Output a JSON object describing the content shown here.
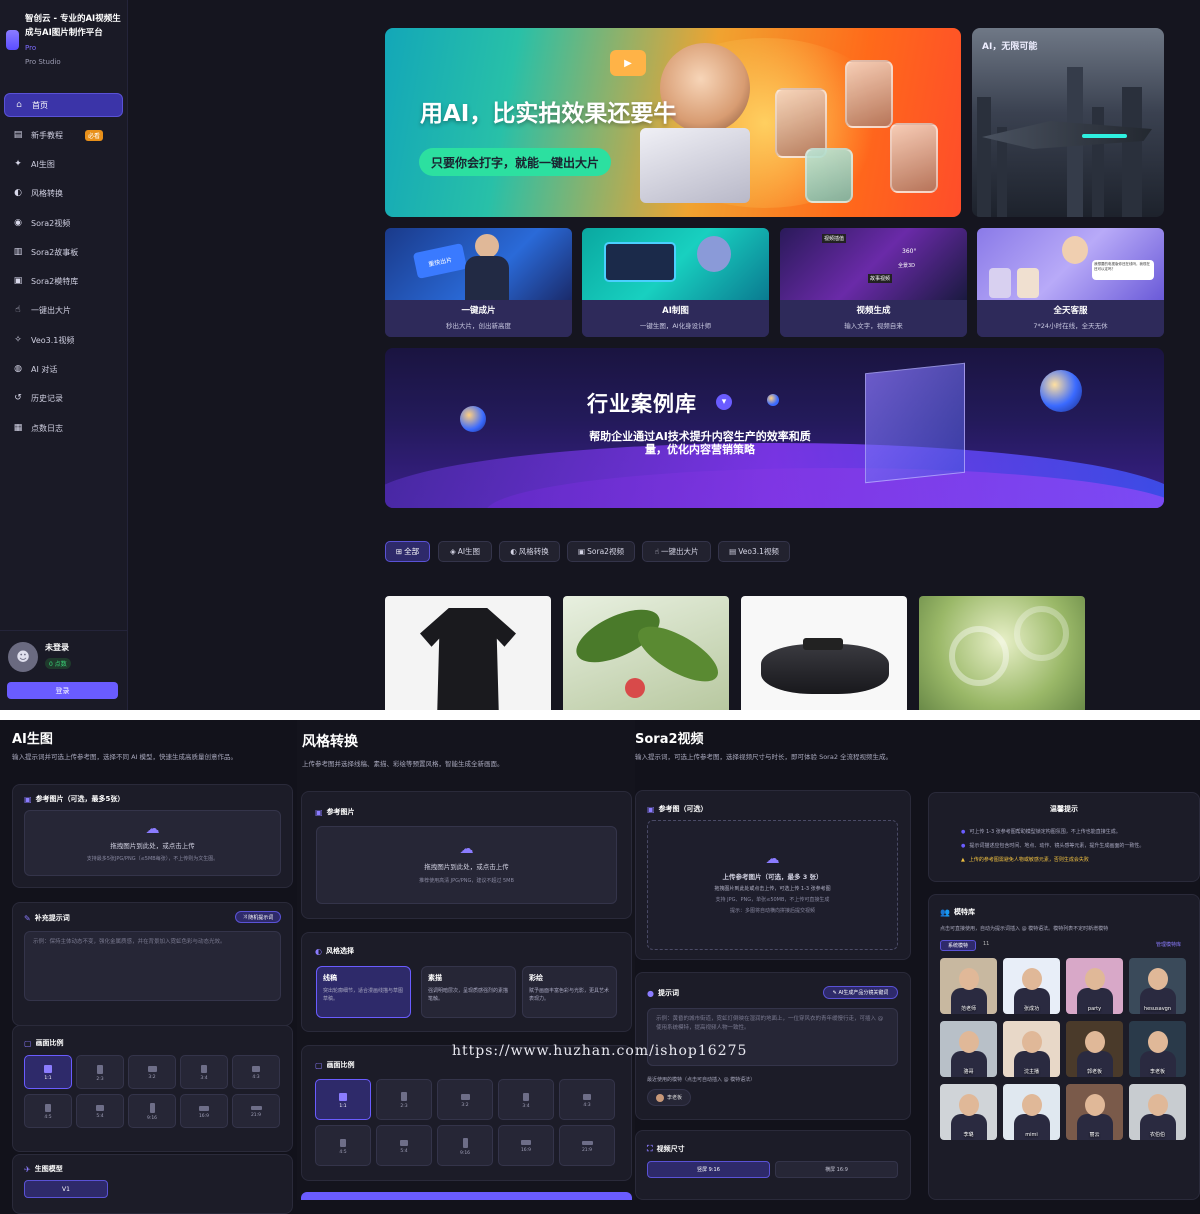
{
  "brand": {
    "title": "智创云 - 专业的AI视频生成与AI图片制作平台",
    "pro": "Pro",
    "studio": "Pro Studio"
  },
  "nav": [
    {
      "label": "首页",
      "icon": "home-icon",
      "glyph": "⌂"
    },
    {
      "label": "新手教程",
      "icon": "book-icon",
      "glyph": "▤",
      "badge": "必看"
    },
    {
      "label": "AI生图",
      "icon": "sparkle-icon",
      "glyph": "✦"
    },
    {
      "label": "风格转换",
      "icon": "palette-icon",
      "glyph": "◐"
    },
    {
      "label": "Sora2视频",
      "icon": "sora-icon",
      "glyph": "◉"
    },
    {
      "label": "Sora2故事板",
      "icon": "storyboard-icon",
      "glyph": "▥"
    },
    {
      "label": "Sora2模特库",
      "icon": "model-icon",
      "glyph": "▣"
    },
    {
      "label": "一键出大片",
      "icon": "thumb-icon",
      "glyph": "☝"
    },
    {
      "label": "Veo3.1视频",
      "icon": "veo-icon",
      "glyph": "✧"
    },
    {
      "label": "AI 对话",
      "icon": "chat-icon",
      "glyph": "◍"
    },
    {
      "label": "历史记录",
      "icon": "history-icon",
      "glyph": "↺"
    },
    {
      "label": "点数日志",
      "icon": "log-icon",
      "glyph": "▦"
    }
  ],
  "user": {
    "name": "未登录",
    "points": "0 点数",
    "login": "登录"
  },
  "hero": {
    "title": "用AI，比实拍效果还要牛",
    "subtitle": "只要你会打字，就能一键出大片"
  },
  "side_banner": {
    "title": "AI，无限可能"
  },
  "features": [
    {
      "title": "一键成片",
      "sub": "秒出大片，创出新高度",
      "tag": "重快出片"
    },
    {
      "title": "AI制图",
      "sub": "一键生图，AI化身设计师"
    },
    {
      "title": "视频生成",
      "sub": "输入文字，视频自来",
      "tag1": "视频插值",
      "tag2": "全景3D",
      "tag3": "故事视频",
      "tag4": "360°"
    },
    {
      "title": "全天客服",
      "sub": "7*24小时在线，全天无休",
      "bubble": "我想要的电视版你还在线吗，我现在还可以定吗？"
    }
  ],
  "industry": {
    "title": "行业案例库",
    "desc": "帮助企业通过AI技术提升内容生产的效率和质量，优化内容营销策略"
  },
  "filters": [
    "全部",
    "AI生图",
    "风格转换",
    "Sora2视频",
    "一键出大片",
    "Veo3.1视频"
  ],
  "ai_gen": {
    "title": "AI生图",
    "desc": "输入提示词并可选上传参考图，选择不同 AI 模型，快速生成高质量创意作品。",
    "ref_label": "参考图片（可选，最多5张）",
    "drop_main": "拖拽图片到此处，或点击上传",
    "drop_hint": "支持最多5张JPG/PNG（≤5MB每张），不上传则为文生图。",
    "prompt_label": "补充提示词",
    "random_btn": "随机提示词",
    "prompt_placeholder": "示例：保持主体动态不变，强化金属质感，并在背景加入霓虹色彩与动态光效。",
    "ratio_label": "画面比例",
    "ratios": [
      "1:1",
      "2:3",
      "3:2",
      "3:4",
      "4:3",
      "4:5",
      "5:4",
      "9:16",
      "16:9",
      "21:9"
    ],
    "model_label": "生图模型",
    "model_value": "V1"
  },
  "style": {
    "title": "风格转换",
    "desc": "上传参考图并选择线稿、素描、彩绘等预置风格，智能生成全新画面。",
    "ref_label": "参考图片",
    "drop_main": "拖拽图片到此处，或点击上传",
    "drop_hint": "推荐使用高清 JPG/PNG，建议不超过 5MB",
    "select_label": "风格选择",
    "styles": [
      {
        "name": "线稿",
        "desc": "突出轮廓细节，适合漫画线描与草图草稿。"
      },
      {
        "name": "素描",
        "desc": "强调明暗层次，呈现质感强烈的素描笔触。"
      },
      {
        "name": "彩绘",
        "desc": "赋予画面丰富色彩与光影，更具艺术表现力。"
      }
    ],
    "ratio_label": "画面比例",
    "ratios": [
      "1:1",
      "2:3",
      "3:2",
      "3:4",
      "4:3",
      "4:5",
      "5:4",
      "9:16",
      "16:9",
      "21:9"
    ]
  },
  "sora": {
    "title": "Sora2视频",
    "desc": "输入提示词，可选上传参考图，选择视频尺寸与时长，即可体验 Sora2 全流程视频生成。",
    "ref_label": "参考图（可选）",
    "drop_main": "上传参考图片（可选，最多 3 张）",
    "drop_sub": "拖拽图片到此处或点击上传，可选上传 1-3 张参考图",
    "drop_hint": "支持 JPG、PNG，单张≤50MB，不上传可直接生成",
    "drop_hint2": "提示：多图将自动横向拼接后提交视频",
    "prompt_label": "提示词",
    "ai_btn": "AI生成产品分镜关键词",
    "prompt_placeholder": "示例：黄昏的城市街道，霓虹灯倒映在湿润的地面上，一位穿风衣的青年缓慢行走，可插入 @ 使用系统模特，提高视频人物一致性。",
    "recent_label": "最近使用的模特（点击可自动插入 @ 模特语法）",
    "recent_model": "李老板",
    "size_label": "视频尺寸",
    "size_vertical": "竖屏 9:16",
    "size_horizontal": "横屏 16:9"
  },
  "tips": {
    "title": "温馨提示",
    "lines": [
      "可上传 1-3 张参考图帮助模型锁定构图氛围，不上传也能直接生成。",
      "提示词描述应包含时间、地点、动作、镜头感等元素，提升生成画面的一致性。",
      "上传的参考图需避免人物或敏感元素，否则生成会失败"
    ]
  },
  "models": {
    "title": "模特库",
    "desc": "点击可直接使用，自动为提示词插入 @ 模特语法。模特列表不定时新增模特",
    "tab": "系统模特",
    "count": "11",
    "manage": "管理模特库",
    "list": [
      "范老师",
      "张成功",
      "party",
      "hesusavgn",
      "骆哥",
      "沈主播",
      "郭老板",
      "李老板",
      "李璐",
      "mimi",
      "丽云",
      "农伯伯"
    ]
  },
  "watermark": "https://www.huzhan.com/ishop16275",
  "colors": {
    "accent": "#6a5cff",
    "bg": "#15151f",
    "panel": "#1c1c28"
  }
}
